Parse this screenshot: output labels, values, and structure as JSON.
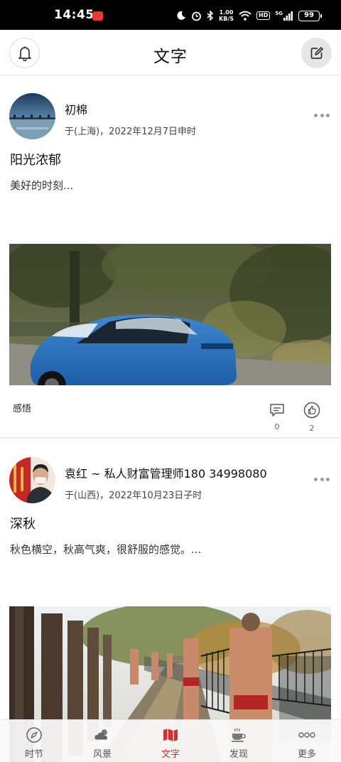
{
  "status_bar": {
    "time": "14:45",
    "net_speed_value": "1.00",
    "net_speed_unit": "KB/S",
    "hd": "HD",
    "network": "5G",
    "battery": "99"
  },
  "header": {
    "title": "文字",
    "bell_icon": "bell-icon",
    "edit_icon": "edit-icon"
  },
  "posts": [
    {
      "author": "初棉",
      "meta": "于(上海)，2022年12月7日申时",
      "title": "阳光浓郁",
      "excerpt": "美好的时刻...",
      "tag": "感悟",
      "comments": "0",
      "likes": "2"
    },
    {
      "author": "袁红 ~ 私人财富管理师180 34998080",
      "meta": "于(山西)，2022年10月23日子时",
      "title": "深秋",
      "excerpt": "秋色横空，秋高气爽，很舒服的感觉。..."
    }
  ],
  "bottom_nav": [
    {
      "label": "时节",
      "icon": "compass-icon"
    },
    {
      "label": "风景",
      "icon": "cloud-sun-icon"
    },
    {
      "label": "文字",
      "icon": "map-icon",
      "active": true
    },
    {
      "label": "发现",
      "icon": "coffee-cup-icon"
    },
    {
      "label": "更多",
      "icon": "more-dots-icon"
    }
  ],
  "colors": {
    "accent": "#d32f2f",
    "status_bar_bg": "#000000",
    "nav_inactive": "#555555"
  }
}
